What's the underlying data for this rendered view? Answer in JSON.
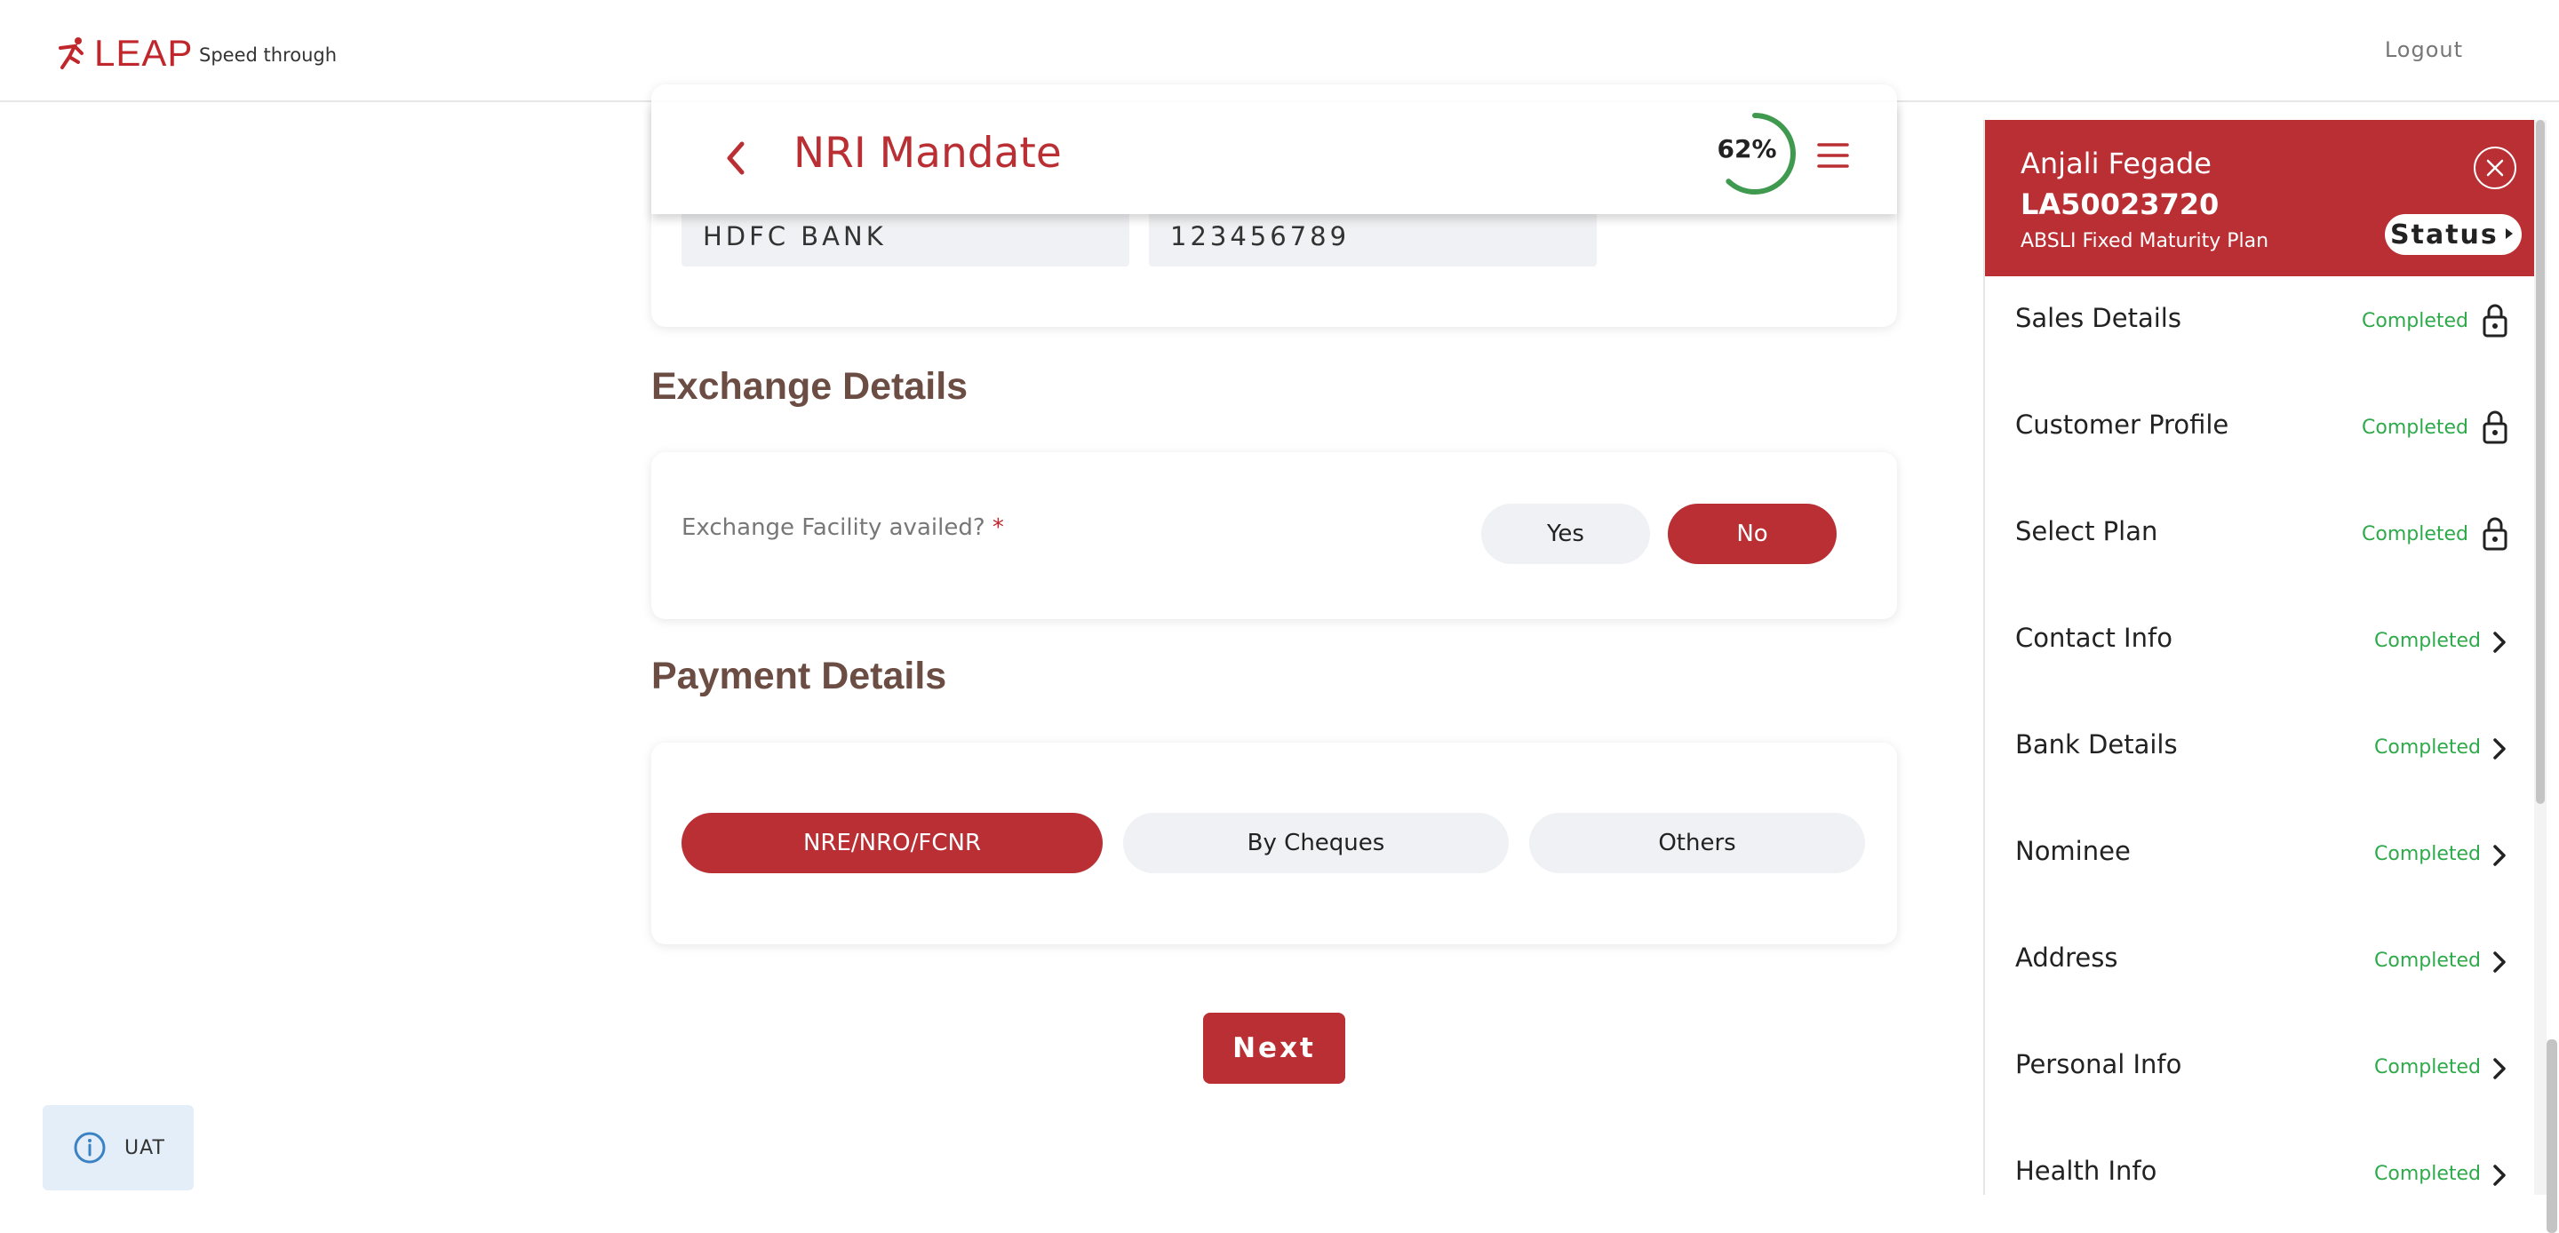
{
  "app": {
    "logo_text": "LEAP",
    "tagline": "Speed through",
    "logout_label": "Logout",
    "brand_color": "#b92f33"
  },
  "header": {
    "title": "NRI Mandate",
    "progress_text": "62%",
    "progress_value": 62
  },
  "bank": {
    "bank_name": "HDFC BANK",
    "account_number": "123456789"
  },
  "exchange": {
    "section_title": "Exchange Details",
    "question": "Exchange Facility availed?",
    "required_mark": "*",
    "yes_label": "Yes",
    "no_label": "No",
    "selected": "No"
  },
  "payment": {
    "section_title": "Payment Details",
    "options": [
      "NRE/NRO/FCNR",
      "By Cheques",
      "Others"
    ],
    "selected": "NRE/NRO/FCNR"
  },
  "next_label": "Next",
  "env_badge": "UAT",
  "sidebar": {
    "customer_name": "Anjali Fegade",
    "application_id": "LA50023720",
    "plan_name": "ABSLI Fixed Maturity Plan",
    "status_label": "Status",
    "items": [
      {
        "label": "Sales Details",
        "status": "Completed",
        "icon": "lock-icon"
      },
      {
        "label": "Customer Profile",
        "status": "Completed",
        "icon": "lock-icon"
      },
      {
        "label": "Select Plan",
        "status": "Completed",
        "icon": "lock-icon"
      },
      {
        "label": "Contact Info",
        "status": "Completed",
        "icon": "chevron-right-icon"
      },
      {
        "label": "Bank Details",
        "status": "Completed",
        "icon": "chevron-right-icon"
      },
      {
        "label": "Nominee",
        "status": "Completed",
        "icon": "chevron-right-icon"
      },
      {
        "label": "Address",
        "status": "Completed",
        "icon": "chevron-right-icon"
      },
      {
        "label": "Personal Info",
        "status": "Completed",
        "icon": "chevron-right-icon"
      },
      {
        "label": "Health Info",
        "status": "Completed",
        "icon": "chevron-right-icon"
      }
    ]
  }
}
